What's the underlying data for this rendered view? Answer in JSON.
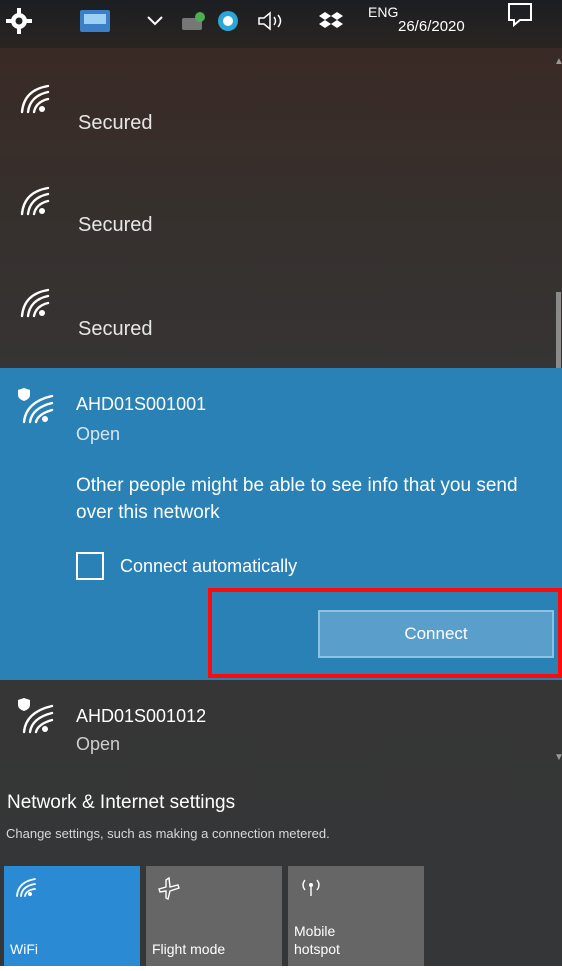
{
  "taskbar": {
    "language": "ENG",
    "date": "26/6/2020"
  },
  "networks": [
    {
      "status": "Secured"
    },
    {
      "status": "Secured"
    },
    {
      "status": "Secured"
    }
  ],
  "active_network": {
    "name": "AHD01S001001",
    "status": "Open",
    "warning": "Other people might be able to see info that you send over this network",
    "auto_connect_label": "Connect automatically",
    "auto_connect_checked": false,
    "connect_label": "Connect"
  },
  "next_network": {
    "name": "AHD01S001012",
    "status": "Open"
  },
  "settings": {
    "title": "Network & Internet settings",
    "subtitle": "Change settings, such as making a connection metered."
  },
  "quick_actions": {
    "wifi_label": "WiFi",
    "flight_label": "Flight mode",
    "hotspot_label_line1": "Mobile",
    "hotspot_label_line2": "hotspot"
  },
  "colors": {
    "accent": "#2a81b6",
    "tile_active": "#2a8ad4",
    "highlight": "#ff0a0a"
  }
}
